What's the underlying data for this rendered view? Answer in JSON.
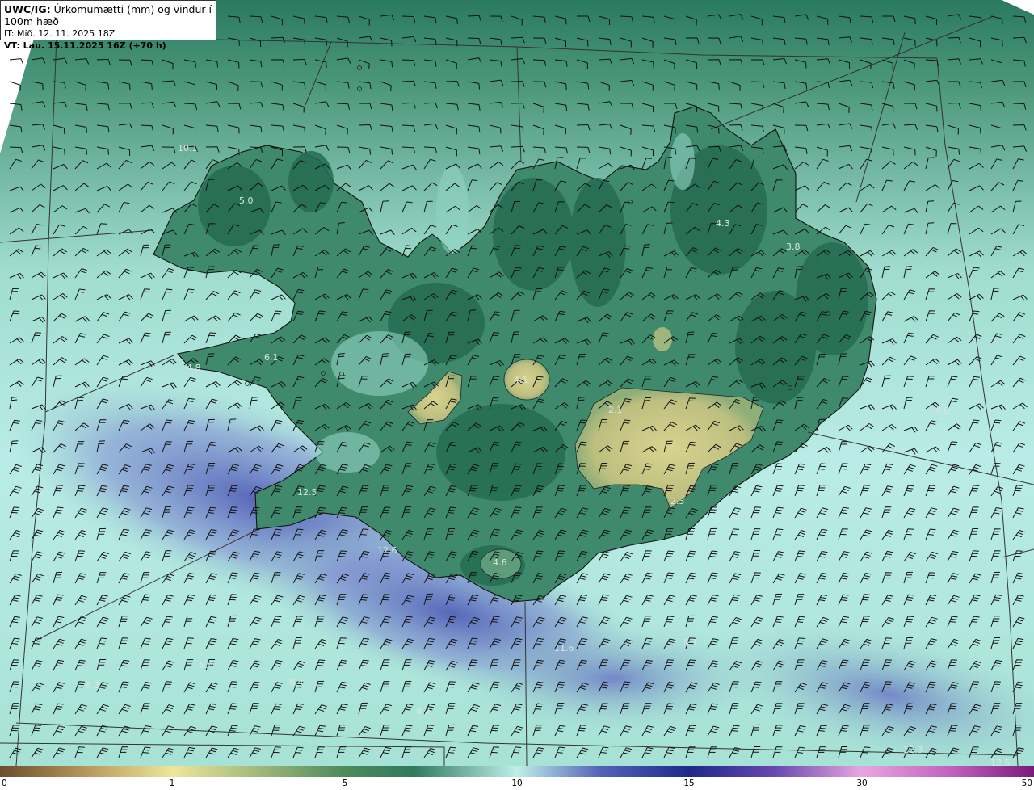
{
  "header": {
    "model": "UWC/IG:",
    "title": "Úrkomumætti (mm) og vindur í 100m hæð",
    "init_time": "IT: Mið. 12. 11. 2025 18Z",
    "valid_prefix": "VT:",
    "valid_time": "Lau. 15.11.2025 16Z (+70 h)"
  },
  "colorbar": {
    "ticks": [
      "0",
      "1",
      "5",
      "10",
      "15",
      "30",
      "50"
    ]
  },
  "map_labels": [
    {
      "text": "10.1"
    },
    {
      "text": "5.0"
    },
    {
      "text": "4.3"
    },
    {
      "text": "3.8"
    },
    {
      "text": "6.1"
    },
    {
      "text": "4.8"
    },
    {
      "text": "4.1"
    },
    {
      "text": "2.1"
    },
    {
      "text": "2.3"
    },
    {
      "text": "9.0"
    },
    {
      "text": "12.5"
    },
    {
      "text": "12.6"
    },
    {
      "text": "4.6"
    },
    {
      "text": "11.6"
    },
    {
      "text": "8.1"
    },
    {
      "text": "8.4"
    },
    {
      "text": "8.4"
    },
    {
      "text": "8.3"
    },
    {
      "text": "8.2"
    },
    {
      "text": "12.3"
    },
    {
      "text": "12.5"
    }
  ],
  "colors": {
    "ocean_light": "#bfeee9",
    "ocean_mid": "#7cc3b0",
    "land_dark": "#2f7a5e",
    "glacier_yellow": "#c9c88a",
    "precip_blue": "#5b6bbd"
  }
}
